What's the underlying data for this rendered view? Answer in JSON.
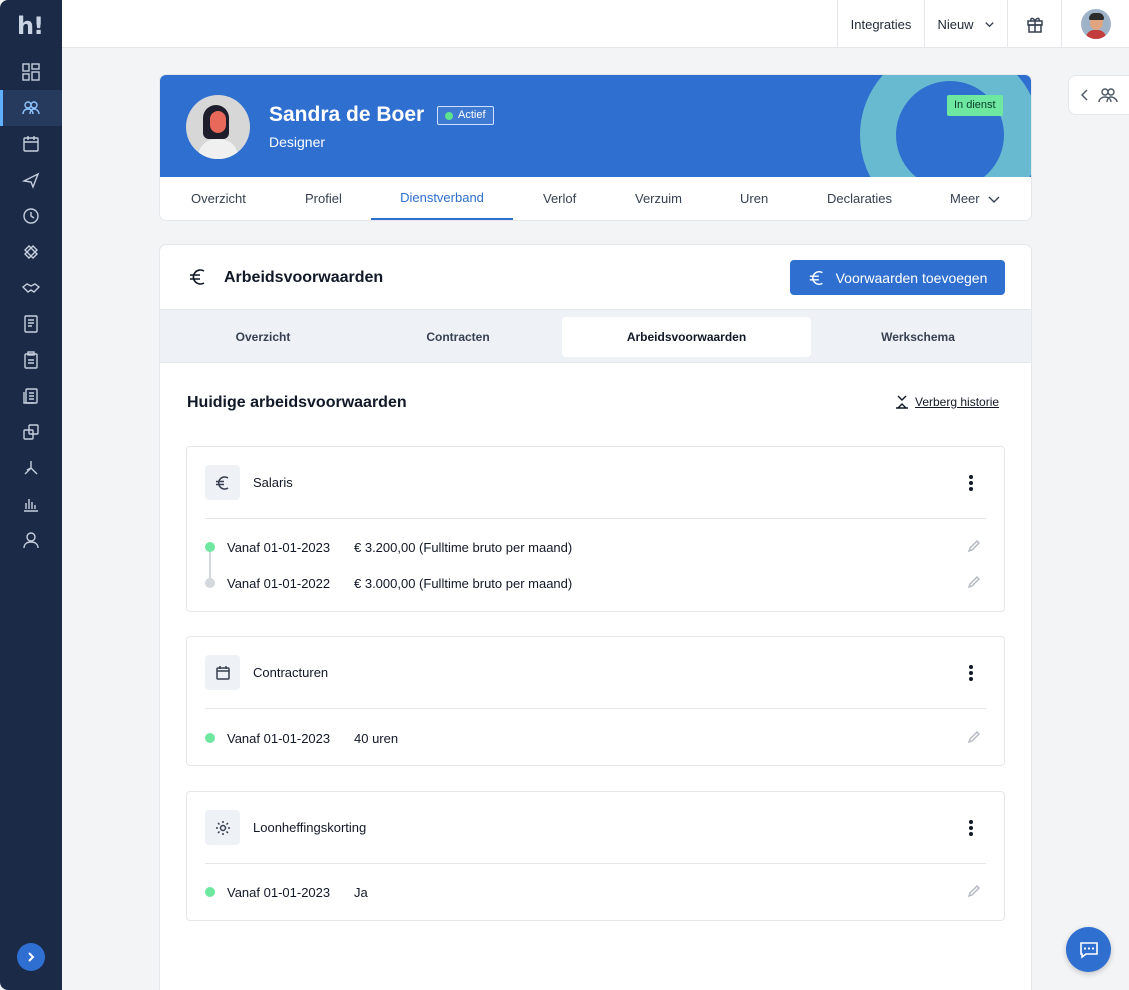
{
  "app": {
    "logo": "h!"
  },
  "sidebar": {
    "items": [
      {
        "icon": "dashboard-icon"
      },
      {
        "icon": "people-icon",
        "active": true
      },
      {
        "icon": "calendar-icon"
      },
      {
        "icon": "plane-icon"
      },
      {
        "icon": "clock-icon"
      },
      {
        "icon": "bandage-icon"
      },
      {
        "icon": "handshake-icon"
      },
      {
        "icon": "receipt-icon"
      },
      {
        "icon": "clipboard-icon"
      },
      {
        "icon": "documents-icon"
      },
      {
        "icon": "transfer-icon"
      },
      {
        "icon": "org-chart-icon"
      },
      {
        "icon": "bar-chart-icon"
      },
      {
        "icon": "user-icon"
      }
    ]
  },
  "topbar": {
    "integrations": "Integraties",
    "new": "Nieuw"
  },
  "profile": {
    "name": "Sandra de Boer",
    "status": "Actief",
    "role": "Designer",
    "service_badge": "In dienst",
    "tabs": [
      "Overzicht",
      "Profiel",
      "Dienstverband",
      "Verlof",
      "Verzuim",
      "Uren",
      "Declaraties",
      "Meer"
    ],
    "active_tab": "Dienstverband"
  },
  "section": {
    "title": "Arbeidsvoorwaarden",
    "add_button": "Voorwaarden toevoegen",
    "subtabs": [
      "Overzicht",
      "Contracten",
      "Arbeidsvoorwaarden",
      "Werkschema"
    ],
    "active_subtab": "Arbeidsvoorwaarden",
    "current_title": "Huidige arbeidsvoorwaarden",
    "history_link": "Verberg historie"
  },
  "blocks": [
    {
      "title": "Salaris",
      "icon": "euro-icon",
      "rows": [
        {
          "date": "Vanaf 01-01-2023",
          "value": "€ 3.200,00 (Fulltime bruto per maand)",
          "status": "current"
        },
        {
          "date": "Vanaf 01-01-2022",
          "value": "€ 3.000,00 (Fulltime bruto per maand)",
          "status": "past"
        }
      ]
    },
    {
      "title": "Contracturen",
      "icon": "calendar-icon",
      "rows": [
        {
          "date": "Vanaf 01-01-2023",
          "value": "40 uren",
          "status": "current"
        }
      ]
    },
    {
      "title": "Loonheffingskorting",
      "icon": "gear-icon",
      "rows": [
        {
          "date": "Vanaf 01-01-2023",
          "value": "Ja",
          "status": "current"
        }
      ]
    }
  ],
  "colors": {
    "sidebar": "#1b2a47",
    "accent": "#2f6fcf",
    "active_dot": "#6ee7a0",
    "past_dot": "#d4d7dc"
  }
}
